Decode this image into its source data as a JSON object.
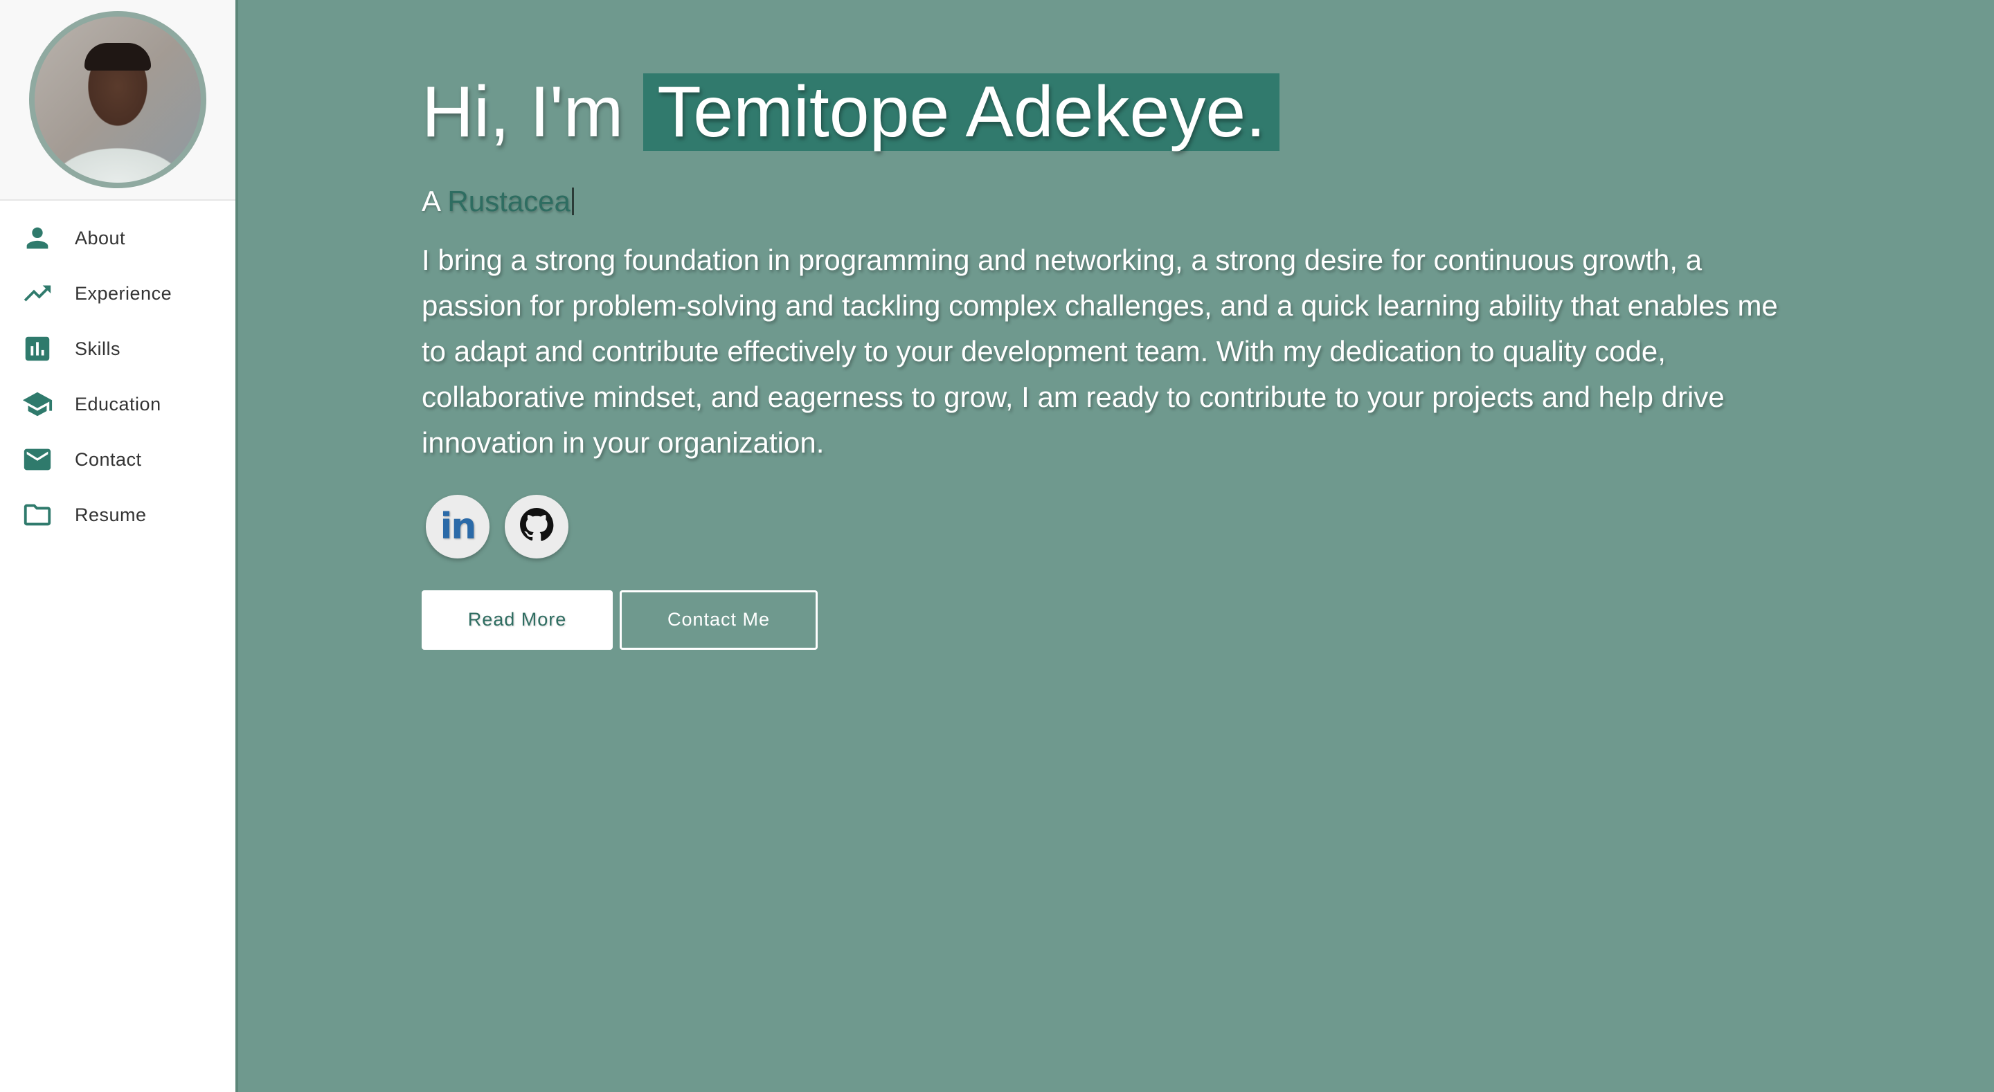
{
  "sidebar": {
    "avatar_alt": "Profile photo",
    "items": [
      {
        "label": "About",
        "icon": "person-icon"
      },
      {
        "label": "Experience",
        "icon": "trending-up-icon"
      },
      {
        "label": "Skills",
        "icon": "bar-chart-icon"
      },
      {
        "label": "Education",
        "icon": "graduation-cap-icon"
      },
      {
        "label": "Contact",
        "icon": "mail-icon"
      },
      {
        "label": "Resume",
        "icon": "folder-icon"
      }
    ]
  },
  "hero": {
    "greeting": "Hi, I'm",
    "name": "Temitope Adekeye.",
    "tagline_prefix": "A",
    "tagline_role": "Rustacea",
    "bio": "I bring a strong foundation in programming and networking, a strong desire for continuous growth, a passion for problem-solving and tackling complex challenges, and a quick learning ability that enables me to adapt and contribute effectively to your development team. With my dedication to quality code, collaborative mindset, and eagerness to grow, I am ready to contribute to your projects and help drive innovation in your organization.",
    "socials": [
      {
        "name": "linkedin",
        "glyph": "in",
        "icon": "linkedin-icon"
      },
      {
        "name": "github",
        "icon": "github-icon"
      }
    ],
    "buttons": {
      "read_more": "Read More",
      "contact_me": "Contact Me"
    }
  },
  "colors": {
    "main_bg": "#6f998e",
    "accent": "#317a6d",
    "icon": "#2f7a6c",
    "sidebar_bg": "#ffffff"
  }
}
